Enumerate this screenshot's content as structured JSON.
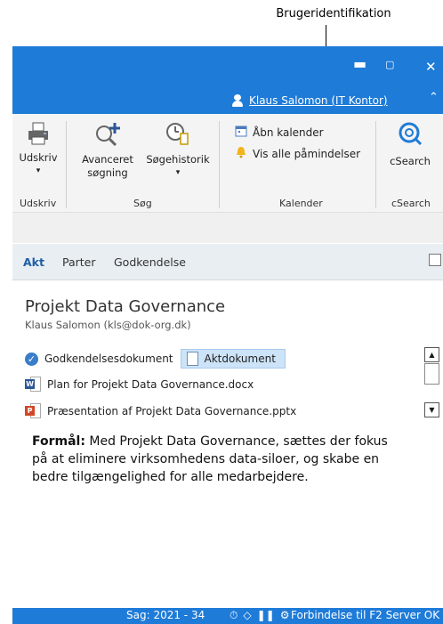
{
  "callout": {
    "label": "Brugeridentifikation"
  },
  "window": {
    "minimize": "▬",
    "maximize": "▢",
    "close": "✕",
    "user_name": "Klaus Salomon (IT Kontor)",
    "collapse": "⌃"
  },
  "ribbon": {
    "print_label": "Udskriv",
    "print_arrow": "▾",
    "print_group": "Udskriv",
    "advanced_search_label_1": "Avanceret",
    "advanced_search_label_2": "søgning",
    "search_history_label": "Søgehistorik",
    "search_history_arrow": "▾",
    "search_group": "Søg",
    "open_calendar": "Åbn kalender",
    "show_reminders": "Vis alle påmindelser",
    "calendar_group": "Kalender",
    "csearch_label": "cSearch",
    "csearch_group": "cSearch"
  },
  "tabs": [
    "Akt",
    "Parter",
    "Godkendelse"
  ],
  "case": {
    "title": "Projekt Data Governance",
    "owner": "Klaus Salomon (kls@dok-org.dk)"
  },
  "documents": {
    "approval_doc": "Godkendelsesdokument",
    "record_doc": "Aktdokument",
    "files": [
      {
        "name": "Plan for Projekt Data Governance.docx",
        "type": "word"
      },
      {
        "name": "Præsentation af Projekt Data Governance.pptx",
        "type": "ppt"
      }
    ]
  },
  "description": {
    "label": "Formål:",
    "text": " Med Projekt Data Governance, sættes der fokus på at eliminere virksomhedens data-siloer, og skabe en bedre tilgængelighed for alle medarbejdere."
  },
  "status": {
    "case": "Sag: 2021 - 34",
    "connection": "Forbindelse til F2 Server OK"
  },
  "colors": {
    "accent": "#1e7bd8",
    "tab_active": "#1e5fa6",
    "selection": "#cde3f7"
  }
}
